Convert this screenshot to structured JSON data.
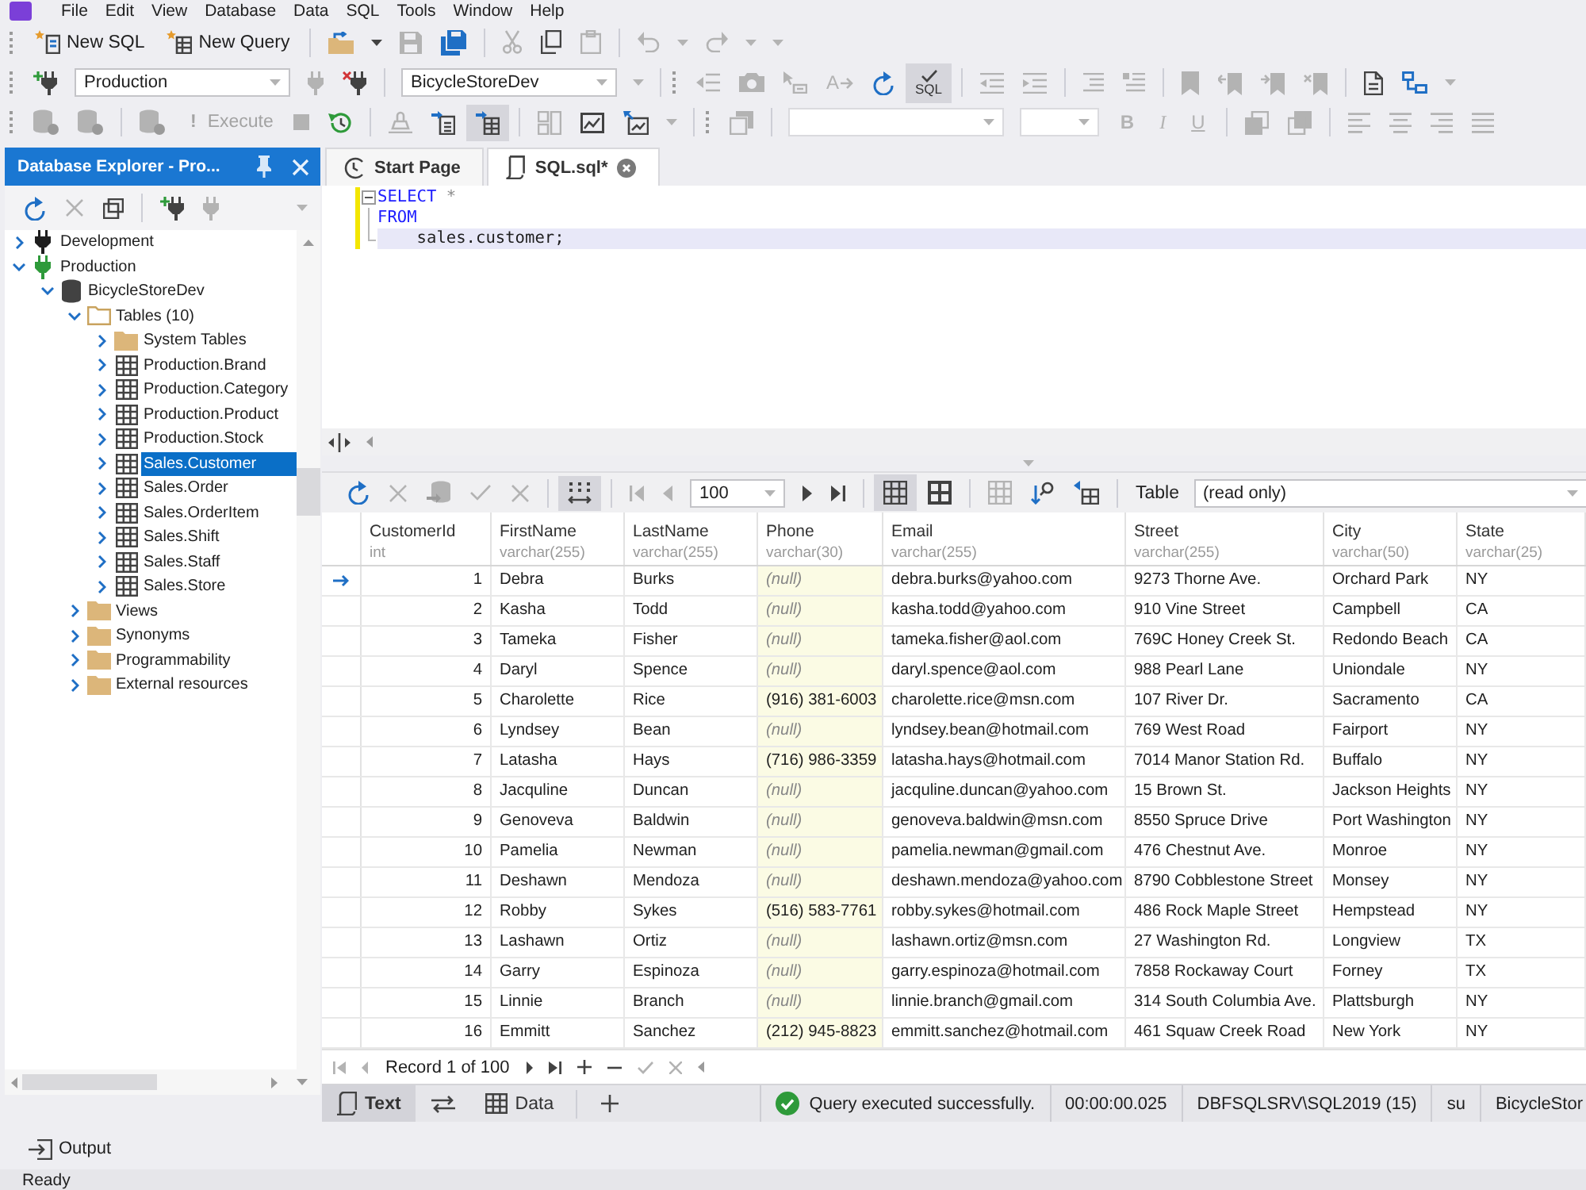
{
  "menu": [
    "File",
    "Edit",
    "View",
    "Database",
    "Data",
    "SQL",
    "Tools",
    "Window",
    "Help"
  ],
  "toolbars": [
    [
      {
        "kind": "grip"
      },
      {
        "kind": "button",
        "label": "New SQL",
        "disabled": false
      },
      {
        "kind": "button",
        "label": "New Query",
        "disabled": false
      },
      {
        "kind": "separator"
      },
      {
        "kind": "icon",
        "disabled": false,
        "pressed": false
      },
      {
        "kind": "caret",
        "disabled": false
      },
      {
        "kind": "icon",
        "disabled": true,
        "pressed": false
      },
      {
        "kind": "icon",
        "disabled": false,
        "pressed": false
      },
      {
        "kind": "separator"
      },
      {
        "kind": "icon",
        "disabled": true,
        "pressed": false
      },
      {
        "kind": "icon",
        "disabled": false,
        "pressed": false
      },
      {
        "kind": "icon",
        "disabled": true,
        "pressed": false
      },
      {
        "kind": "separator"
      },
      {
        "kind": "icon",
        "disabled": true,
        "pressed": false
      },
      {
        "kind": "caret",
        "disabled": true
      },
      {
        "kind": "icon",
        "disabled": true,
        "pressed": false
      },
      {
        "kind": "caret",
        "disabled": true
      },
      {
        "kind": "caret",
        "disabled": true
      }
    ],
    [
      {
        "kind": "grip"
      },
      {
        "kind": "icon",
        "disabled": false,
        "pressed": false
      },
      {
        "kind": "combo",
        "value": "Production",
        "disabled": false
      },
      {
        "kind": "icon",
        "disabled": true,
        "pressed": false
      },
      {
        "kind": "icon",
        "disabled": false,
        "pressed": false
      },
      {
        "kind": "separator"
      },
      {
        "kind": "combo",
        "value": "BicycleStoreDev",
        "disabled": false
      },
      {
        "kind": "caret",
        "disabled": true
      },
      {
        "kind": "separator"
      },
      {
        "kind": "grip"
      },
      {
        "kind": "icon",
        "disabled": true,
        "pressed": false
      },
      {
        "kind": "icon",
        "disabled": true,
        "pressed": false
      },
      {
        "kind": "icon",
        "disabled": true,
        "pressed": false
      },
      {
        "kind": "icon",
        "text": "A",
        "disabled": true,
        "pressed": false
      },
      {
        "kind": "icon",
        "disabled": false,
        "pressed": false
      },
      {
        "kind": "icon",
        "text": "SQL",
        "disabled": false,
        "pressed": true
      },
      {
        "kind": "separator"
      },
      {
        "kind": "icon",
        "disabled": true,
        "pressed": false
      },
      {
        "kind": "icon",
        "disabled": true,
        "pressed": false
      },
      {
        "kind": "separator"
      },
      {
        "kind": "icon",
        "disabled": true,
        "pressed": false
      },
      {
        "kind": "icon",
        "disabled": true,
        "pressed": false
      },
      {
        "kind": "separator"
      },
      {
        "kind": "icon",
        "disabled": true,
        "pressed": false
      },
      {
        "kind": "icon",
        "disabled": true,
        "pressed": false
      },
      {
        "kind": "icon",
        "disabled": true,
        "pressed": false
      },
      {
        "kind": "icon",
        "disabled": true,
        "pressed": false
      },
      {
        "kind": "separator"
      },
      {
        "kind": "icon",
        "disabled": false,
        "pressed": false
      },
      {
        "kind": "icon",
        "disabled": false,
        "pressed": false
      },
      {
        "kind": "caret",
        "disabled": true
      }
    ],
    [
      {
        "kind": "grip"
      },
      {
        "kind": "icon",
        "disabled": true,
        "pressed": false
      },
      {
        "kind": "icon",
        "disabled": true,
        "pressed": false
      },
      {
        "kind": "separator"
      },
      {
        "kind": "icon",
        "disabled": true,
        "pressed": false
      },
      {
        "kind": "button",
        "glyph": "!",
        "label": "Execute",
        "disabled": true
      },
      {
        "kind": "icon",
        "disabled": true,
        "pressed": false
      },
      {
        "kind": "icon",
        "disabled": false,
        "pressed": false
      },
      {
        "kind": "separator"
      },
      {
        "kind": "icon",
        "disabled": true,
        "pressed": false
      },
      {
        "kind": "icon",
        "disabled": false,
        "pressed": false
      },
      {
        "kind": "icon",
        "disabled": false,
        "pressed": true
      },
      {
        "kind": "separator"
      },
      {
        "kind": "icon",
        "disabled": true,
        "pressed": false
      },
      {
        "kind": "icon",
        "disabled": false,
        "pressed": false
      },
      {
        "kind": "icon",
        "disabled": false,
        "pressed": false
      },
      {
        "kind": "caret",
        "disabled": true
      },
      {
        "kind": "separator"
      },
      {
        "kind": "grip"
      },
      {
        "kind": "icon",
        "disabled": true,
        "pressed": false
      },
      {
        "kind": "separator"
      },
      {
        "kind": "combo",
        "disabled": true
      },
      {
        "kind": "combo",
        "disabled": true
      },
      {
        "kind": "glyph",
        "text": "B",
        "disabled": true
      },
      {
        "kind": "glyph",
        "text": "I",
        "disabled": true
      },
      {
        "kind": "glyph",
        "text": "U",
        "disabled": true
      },
      {
        "kind": "separator"
      },
      {
        "kind": "icon",
        "disabled": true,
        "pressed": false
      },
      {
        "kind": "icon",
        "disabled": true,
        "pressed": false
      },
      {
        "kind": "separator"
      },
      {
        "kind": "icon",
        "disabled": true,
        "pressed": false
      },
      {
        "kind": "icon",
        "disabled": true,
        "pressed": false
      },
      {
        "kind": "icon",
        "disabled": true,
        "pressed": false
      },
      {
        "kind": "icon",
        "disabled": true,
        "pressed": false
      }
    ]
  ],
  "explorer": {
    "title": "Database Explorer - Pro...",
    "toolbar": [
      {
        "kind": "icon",
        "disabled": false,
        "pressed": false
      },
      {
        "kind": "icon",
        "disabled": true,
        "pressed": false
      },
      {
        "kind": "icon",
        "disabled": false,
        "pressed": false
      },
      {
        "kind": "separator"
      },
      {
        "kind": "icon",
        "disabled": false,
        "pressed": false
      },
      {
        "kind": "icon",
        "disabled": true,
        "pressed": false
      },
      {
        "kind": "caret",
        "disabled": true
      }
    ],
    "tree": [
      {
        "label": "Development",
        "kind": "connection",
        "color": "#1e1e1e",
        "expanded": false,
        "selected": false
      },
      {
        "label": "Production",
        "kind": "connection",
        "color": "#2e9a3a",
        "expanded": true,
        "selected": false,
        "children": [
          {
            "label": "BicycleStoreDev",
            "kind": "database",
            "expanded": true,
            "selected": false,
            "children": [
              {
                "label": "Tables (10)",
                "kind": "folder",
                "expanded": true,
                "selected": false,
                "children": [
                  {
                    "label": "System Tables",
                    "kind": "folder",
                    "expanded": false,
                    "selected": false
                  },
                  {
                    "label": "Production.Brand",
                    "kind": "table",
                    "expanded": false,
                    "selected": false
                  },
                  {
                    "label": "Production.Category",
                    "kind": "table",
                    "expanded": false,
                    "selected": false
                  },
                  {
                    "label": "Production.Product",
                    "kind": "table",
                    "expanded": false,
                    "selected": false
                  },
                  {
                    "label": "Production.Stock",
                    "kind": "table",
                    "expanded": false,
                    "selected": false
                  },
                  {
                    "label": "Sales.Customer",
                    "kind": "table",
                    "expanded": false,
                    "selected": true
                  },
                  {
                    "label": "Sales.Order",
                    "kind": "table",
                    "expanded": false,
                    "selected": false
                  },
                  {
                    "label": "Sales.OrderItem",
                    "kind": "table",
                    "expanded": false,
                    "selected": false
                  },
                  {
                    "label": "Sales.Shift",
                    "kind": "table",
                    "expanded": false,
                    "selected": false
                  },
                  {
                    "label": "Sales.Staff",
                    "kind": "table",
                    "expanded": false,
                    "selected": false
                  },
                  {
                    "label": "Sales.Store",
                    "kind": "table",
                    "expanded": false,
                    "selected": false
                  }
                ]
              },
              {
                "label": "Views",
                "kind": "folder",
                "expanded": false,
                "selected": false
              },
              {
                "label": "Synonyms",
                "kind": "folder",
                "expanded": false,
                "selected": false
              },
              {
                "label": "Programmability",
                "kind": "folder",
                "expanded": false,
                "selected": false
              },
              {
                "label": "External resources",
                "kind": "folder",
                "expanded": false,
                "selected": false
              }
            ]
          }
        ]
      }
    ]
  },
  "documents": [
    {
      "label": "Start Page",
      "kind": "start",
      "selected": false
    },
    {
      "label": "SQL.sql*",
      "kind": "sql",
      "selected": true
    }
  ],
  "editor": {
    "lines": [
      {
        "kind": "start",
        "modified": true,
        "current": false,
        "tokens": [
          {
            "text": "SELECT",
            "kind": "keyword"
          },
          {
            "text": " *",
            "kind": "operator"
          }
        ]
      },
      {
        "kind": "inner",
        "modified": true,
        "current": false,
        "tokens": [
          {
            "text": "FROM",
            "kind": "keyword"
          }
        ]
      },
      {
        "kind": "end",
        "modified": true,
        "current": true,
        "tokens": [
          {
            "text": "    sales.customer;",
            "kind": "identifier"
          }
        ]
      }
    ]
  },
  "grid": {
    "toolbar": [
      {
        "kind": "icon",
        "disabled": false,
        "pressed": false
      },
      {
        "kind": "icon",
        "disabled": true,
        "pressed": false
      },
      {
        "kind": "icon",
        "disabled": true,
        "pressed": false
      },
      {
        "kind": "icon",
        "disabled": true,
        "pressed": false
      },
      {
        "kind": "icon",
        "disabled": true,
        "pressed": false
      },
      {
        "kind": "separator"
      },
      {
        "kind": "icon",
        "disabled": false,
        "pressed": true
      },
      {
        "kind": "separator"
      },
      {
        "kind": "icon",
        "disabled": true,
        "pressed": false
      },
      {
        "kind": "icon",
        "disabled": true,
        "pressed": false
      },
      {
        "kind": "combo",
        "value": "100",
        "disabled": false
      },
      {
        "kind": "icon",
        "disabled": false,
        "pressed": false
      },
      {
        "kind": "icon",
        "disabled": false,
        "pressed": false
      },
      {
        "kind": "separator"
      },
      {
        "kind": "icon",
        "disabled": false,
        "pressed": true
      },
      {
        "kind": "icon",
        "disabled": false,
        "pressed": false
      },
      {
        "kind": "separator"
      },
      {
        "kind": "icon",
        "disabled": true,
        "pressed": false
      },
      {
        "kind": "icon",
        "disabled": false,
        "pressed": false
      },
      {
        "kind": "icon",
        "disabled": false,
        "pressed": false
      },
      {
        "kind": "separator"
      },
      {
        "kind": "label",
        "text": "Table"
      },
      {
        "kind": "combo",
        "value": "(read only)",
        "disabled": false
      }
    ],
    "columns": [
      {
        "name": "CustomerId",
        "type": "int",
        "numeric": true,
        "selected": false
      },
      {
        "name": "FirstName",
        "type": "varchar(255)",
        "numeric": false,
        "selected": false
      },
      {
        "name": "LastName",
        "type": "varchar(255)",
        "numeric": false,
        "selected": false
      },
      {
        "name": "Phone",
        "type": "varchar(30)",
        "numeric": false,
        "selected": true
      },
      {
        "name": "Email",
        "type": "varchar(255)",
        "numeric": false,
        "selected": false
      },
      {
        "name": "Street",
        "type": "varchar(255)",
        "numeric": false,
        "selected": false
      },
      {
        "name": "City",
        "type": "varchar(50)",
        "numeric": false,
        "selected": false
      },
      {
        "name": "State",
        "type": "varchar(25)",
        "numeric": false,
        "selected": false
      }
    ],
    "rows": [
      {
        "current": true,
        "cells": [
          {
            "text": "1",
            "null": false
          },
          {
            "text": "Debra",
            "null": false
          },
          {
            "text": "Burks",
            "null": false
          },
          {
            "text": "(null)",
            "null": true
          },
          {
            "text": "debra.burks@yahoo.com",
            "null": false
          },
          {
            "text": "9273 Thorne Ave.",
            "null": false
          },
          {
            "text": "Orchard Park",
            "null": false
          },
          {
            "text": "NY",
            "null": false
          }
        ]
      },
      {
        "current": false,
        "cells": [
          {
            "text": "2",
            "null": false
          },
          {
            "text": "Kasha",
            "null": false
          },
          {
            "text": "Todd",
            "null": false
          },
          {
            "text": "(null)",
            "null": true
          },
          {
            "text": "kasha.todd@yahoo.com",
            "null": false
          },
          {
            "text": "910 Vine Street",
            "null": false
          },
          {
            "text": "Campbell",
            "null": false
          },
          {
            "text": "CA",
            "null": false
          }
        ]
      },
      {
        "current": false,
        "cells": [
          {
            "text": "3",
            "null": false
          },
          {
            "text": "Tameka",
            "null": false
          },
          {
            "text": "Fisher",
            "null": false
          },
          {
            "text": "(null)",
            "null": true
          },
          {
            "text": "tameka.fisher@aol.com",
            "null": false
          },
          {
            "text": "769C Honey Creek St.",
            "null": false
          },
          {
            "text": "Redondo Beach",
            "null": false
          },
          {
            "text": "CA",
            "null": false
          }
        ]
      },
      {
        "current": false,
        "cells": [
          {
            "text": "4",
            "null": false
          },
          {
            "text": "Daryl",
            "null": false
          },
          {
            "text": "Spence",
            "null": false
          },
          {
            "text": "(null)",
            "null": true
          },
          {
            "text": "daryl.spence@aol.com",
            "null": false
          },
          {
            "text": "988 Pearl Lane",
            "null": false
          },
          {
            "text": "Uniondale",
            "null": false
          },
          {
            "text": "NY",
            "null": false
          }
        ]
      },
      {
        "current": false,
        "cells": [
          {
            "text": "5",
            "null": false
          },
          {
            "text": "Charolette",
            "null": false
          },
          {
            "text": "Rice",
            "null": false
          },
          {
            "text": "(916) 381-6003",
            "null": false
          },
          {
            "text": "charolette.rice@msn.com",
            "null": false
          },
          {
            "text": "107 River Dr.",
            "null": false
          },
          {
            "text": "Sacramento",
            "null": false
          },
          {
            "text": "CA",
            "null": false
          }
        ]
      },
      {
        "current": false,
        "cells": [
          {
            "text": "6",
            "null": false
          },
          {
            "text": "Lyndsey",
            "null": false
          },
          {
            "text": "Bean",
            "null": false
          },
          {
            "text": "(null)",
            "null": true
          },
          {
            "text": "lyndsey.bean@hotmail.com",
            "null": false
          },
          {
            "text": "769 West Road",
            "null": false
          },
          {
            "text": "Fairport",
            "null": false
          },
          {
            "text": "NY",
            "null": false
          }
        ]
      },
      {
        "current": false,
        "cells": [
          {
            "text": "7",
            "null": false
          },
          {
            "text": "Latasha",
            "null": false
          },
          {
            "text": "Hays",
            "null": false
          },
          {
            "text": "(716) 986-3359",
            "null": false
          },
          {
            "text": "latasha.hays@hotmail.com",
            "null": false
          },
          {
            "text": "7014 Manor Station Rd.",
            "null": false
          },
          {
            "text": "Buffalo",
            "null": false
          },
          {
            "text": "NY",
            "null": false
          }
        ]
      },
      {
        "current": false,
        "cells": [
          {
            "text": "8",
            "null": false
          },
          {
            "text": "Jacquline",
            "null": false
          },
          {
            "text": "Duncan",
            "null": false
          },
          {
            "text": "(null)",
            "null": true
          },
          {
            "text": "jacquline.duncan@yahoo.com",
            "null": false
          },
          {
            "text": "15 Brown St.",
            "null": false
          },
          {
            "text": "Jackson Heights",
            "null": false
          },
          {
            "text": "NY",
            "null": false
          }
        ]
      },
      {
        "current": false,
        "cells": [
          {
            "text": "9",
            "null": false
          },
          {
            "text": "Genoveva",
            "null": false
          },
          {
            "text": "Baldwin",
            "null": false
          },
          {
            "text": "(null)",
            "null": true
          },
          {
            "text": "genoveva.baldwin@msn.com",
            "null": false
          },
          {
            "text": "8550 Spruce Drive",
            "null": false
          },
          {
            "text": "Port Washington",
            "null": false
          },
          {
            "text": "NY",
            "null": false
          }
        ]
      },
      {
        "current": false,
        "cells": [
          {
            "text": "10",
            "null": false
          },
          {
            "text": "Pamelia",
            "null": false
          },
          {
            "text": "Newman",
            "null": false
          },
          {
            "text": "(null)",
            "null": true
          },
          {
            "text": "pamelia.newman@gmail.com",
            "null": false
          },
          {
            "text": "476 Chestnut Ave.",
            "null": false
          },
          {
            "text": "Monroe",
            "null": false
          },
          {
            "text": "NY",
            "null": false
          }
        ]
      },
      {
        "current": false,
        "cells": [
          {
            "text": "11",
            "null": false
          },
          {
            "text": "Deshawn",
            "null": false
          },
          {
            "text": "Mendoza",
            "null": false
          },
          {
            "text": "(null)",
            "null": true
          },
          {
            "text": "deshawn.mendoza@yahoo.com",
            "null": false
          },
          {
            "text": "8790 Cobblestone Street",
            "null": false
          },
          {
            "text": "Monsey",
            "null": false
          },
          {
            "text": "NY",
            "null": false
          }
        ]
      },
      {
        "current": false,
        "cells": [
          {
            "text": "12",
            "null": false
          },
          {
            "text": "Robby",
            "null": false
          },
          {
            "text": "Sykes",
            "null": false
          },
          {
            "text": "(516) 583-7761",
            "null": false
          },
          {
            "text": "robby.sykes@hotmail.com",
            "null": false
          },
          {
            "text": "486 Rock Maple Street",
            "null": false
          },
          {
            "text": "Hempstead",
            "null": false
          },
          {
            "text": "NY",
            "null": false
          }
        ]
      },
      {
        "current": false,
        "cells": [
          {
            "text": "13",
            "null": false
          },
          {
            "text": "Lashawn",
            "null": false
          },
          {
            "text": "Ortiz",
            "null": false
          },
          {
            "text": "(null)",
            "null": true
          },
          {
            "text": "lashawn.ortiz@msn.com",
            "null": false
          },
          {
            "text": "27 Washington Rd.",
            "null": false
          },
          {
            "text": "Longview",
            "null": false
          },
          {
            "text": "TX",
            "null": false
          }
        ]
      },
      {
        "current": false,
        "cells": [
          {
            "text": "14",
            "null": false
          },
          {
            "text": "Garry",
            "null": false
          },
          {
            "text": "Espinoza",
            "null": false
          },
          {
            "text": "(null)",
            "null": true
          },
          {
            "text": "garry.espinoza@hotmail.com",
            "null": false
          },
          {
            "text": "7858 Rockaway Court",
            "null": false
          },
          {
            "text": "Forney",
            "null": false
          },
          {
            "text": "TX",
            "null": false
          }
        ]
      },
      {
        "current": false,
        "cells": [
          {
            "text": "15",
            "null": false
          },
          {
            "text": "Linnie",
            "null": false
          },
          {
            "text": "Branch",
            "null": false
          },
          {
            "text": "(null)",
            "null": true
          },
          {
            "text": "linnie.branch@gmail.com",
            "null": false
          },
          {
            "text": "314 South Columbia Ave.",
            "null": false
          },
          {
            "text": "Plattsburgh",
            "null": false
          },
          {
            "text": "NY",
            "null": false
          }
        ]
      },
      {
        "current": false,
        "cells": [
          {
            "text": "16",
            "null": false
          },
          {
            "text": "Emmitt",
            "null": false
          },
          {
            "text": "Sanchez",
            "null": false
          },
          {
            "text": "(212) 945-8823",
            "null": false
          },
          {
            "text": "emmitt.sanchez@hotmail.com",
            "null": false
          },
          {
            "text": "461 Squaw Creek Road",
            "null": false
          },
          {
            "text": "New York",
            "null": false
          },
          {
            "text": "NY",
            "null": false
          }
        ]
      }
    ],
    "navigator": [
      {
        "kind": "icon",
        "disabled": true,
        "pressed": false
      },
      {
        "kind": "icon",
        "disabled": true,
        "pressed": false
      },
      {
        "kind": "label",
        "text": "Record 1 of 100"
      },
      {
        "kind": "icon",
        "disabled": false,
        "pressed": false
      },
      {
        "kind": "icon",
        "disabled": false,
        "pressed": false
      },
      {
        "kind": "icon",
        "disabled": false,
        "pressed": false
      },
      {
        "kind": "icon",
        "disabled": false,
        "pressed": false
      },
      {
        "kind": "icon",
        "disabled": true,
        "pressed": false
      },
      {
        "kind": "icon",
        "disabled": true,
        "pressed": false
      }
    ]
  },
  "result_bar": {
    "tabs": [
      {
        "kind": "tab",
        "label": "Text",
        "selected": true
      },
      {
        "kind": "icon",
        "disabled": false,
        "pressed": false
      },
      {
        "kind": "tab",
        "label": "Data",
        "selected": false
      },
      {
        "kind": "separator"
      },
      {
        "kind": "icon",
        "disabled": false,
        "pressed": false
      }
    ],
    "status": {
      "kind": "success",
      "message": "Query executed successfully.",
      "elapsed": "00:00:00.025",
      "server": "DBFSQLSRV\\SQL2019 (15)",
      "user": "su",
      "database": "BicycleStor"
    }
  },
  "output": {
    "label": "Output"
  },
  "status_bar": {
    "text": "Ready"
  }
}
